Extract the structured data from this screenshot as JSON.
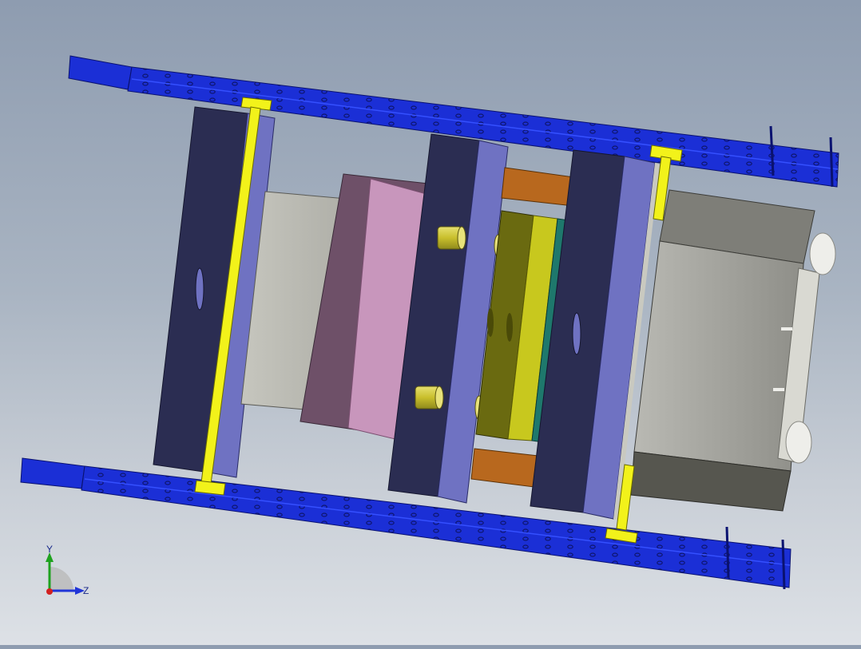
{
  "viewport": {
    "background_top": "#8e9cb0",
    "background_bottom": "#dde1e6"
  },
  "colors": {
    "rail_blue": "#1b2fd6",
    "rail_dark": "#0d1a8a",
    "tie_yellow": "#f2f21a",
    "plate_navy": "#2b2d52",
    "plate_lavender": "#6f72c2",
    "block_gray": "#b3b3aa",
    "pink_block": "#c896bc",
    "mauve_block": "#6e5068",
    "olive_block": "#6a6a10",
    "yellow_block": "#c8c81e",
    "teal_block": "#1e786c",
    "copper_bar": "#b8681e",
    "gold_pin": "#d2c83c",
    "motor_gray": "#9e9e98"
  },
  "triad": {
    "y_label": "Y",
    "z_label": "Z"
  }
}
